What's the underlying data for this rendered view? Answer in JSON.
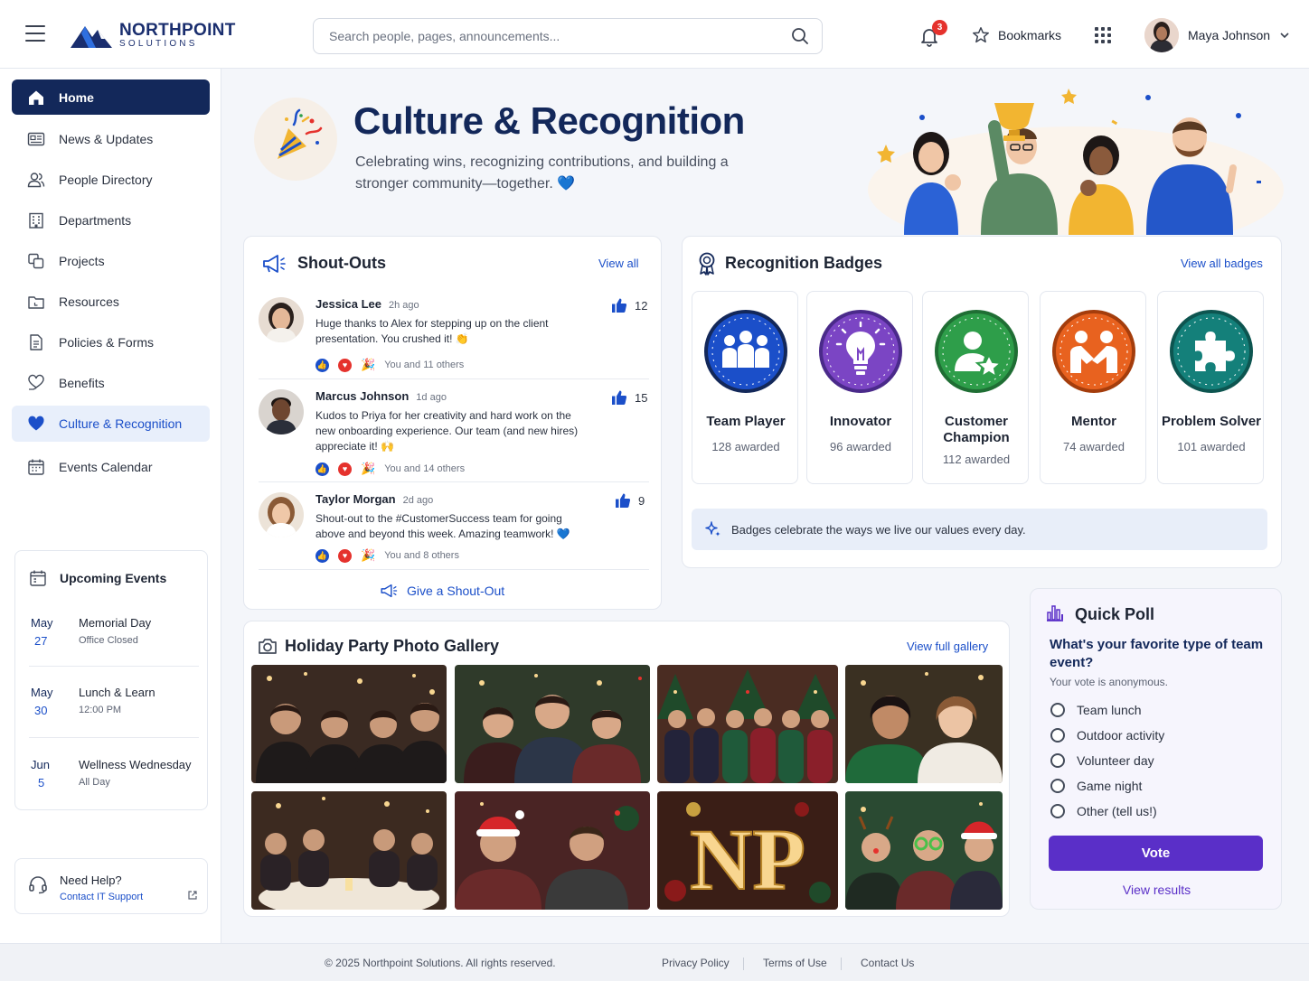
{
  "brand": {
    "name_line1": "NORTHPOINT",
    "name_line2": "SOLUTIONS",
    "color": "#13285a",
    "accent": "#1b4fc9"
  },
  "header": {
    "search_placeholder": "Search people, pages, announcements...",
    "notification_count": "3",
    "bookmarks_label": "Bookmarks",
    "user_name": "Maya Johnson"
  },
  "sidebar": {
    "items": [
      {
        "label": "Home",
        "icon": "home-icon"
      },
      {
        "label": "News & Updates",
        "icon": "newspaper-icon"
      },
      {
        "label": "People Directory",
        "icon": "people-icon"
      },
      {
        "label": "Departments",
        "icon": "building-icon"
      },
      {
        "label": "Projects",
        "icon": "projects-icon"
      },
      {
        "label": "Resources",
        "icon": "folder-icon"
      },
      {
        "label": "Policies & Forms",
        "icon": "document-icon"
      },
      {
        "label": "Benefits",
        "icon": "heart-hand-icon"
      },
      {
        "label": "Culture & Recognition",
        "icon": "heart-icon"
      },
      {
        "label": "Events Calendar",
        "icon": "calendar-icon"
      }
    ],
    "events": {
      "title": "Upcoming Events",
      "list": [
        {
          "month": "May",
          "day": "27",
          "title": "Memorial Day",
          "sub": "Office Closed"
        },
        {
          "month": "May",
          "day": "30",
          "title": "Lunch & Learn",
          "sub": "12:00 PM"
        },
        {
          "month": "Jun",
          "day": "5",
          "title": "Wellness Wednesday",
          "sub": "All Day"
        }
      ]
    },
    "help": {
      "title": "Need Help?",
      "link": "Contact IT Support"
    }
  },
  "hero": {
    "title": "Culture & Recognition",
    "subtitle": "Celebrating wins, recognizing contributions, and building a stronger community—together. 💙"
  },
  "shoutouts": {
    "title": "Shout-Outs",
    "view_all": "View all",
    "items": [
      {
        "name": "Jessica Lee",
        "time": "2h ago",
        "text": "Huge thanks to Alex for stepping up on the client presentation. You crushed it! 👏",
        "likes": "12",
        "reactions": "You and 11 others"
      },
      {
        "name": "Marcus Johnson",
        "time": "1d ago",
        "text": "Kudos to Priya for her creativity and hard work on the new onboarding experience. Our team (and new hires) appreciate it! 🙌",
        "likes": "15",
        "reactions": "You and 14 others"
      },
      {
        "name": "Taylor Morgan",
        "time": "2d ago",
        "text": "Shout-out to the #CustomerSuccess team for going above and beyond this week. Amazing teamwork! 💙",
        "likes": "9",
        "reactions": "You and 8 others"
      }
    ],
    "give_label": "Give a Shout-Out"
  },
  "badges": {
    "title": "Recognition Badges",
    "view_all": "View all badges",
    "items": [
      {
        "name": "Team Player",
        "count": "128 awarded",
        "color": "#1b4fc9",
        "icon": "team-icon"
      },
      {
        "name": "Innovator",
        "count": "96 awarded",
        "color": "#7b45c4",
        "icon": "lightbulb-icon"
      },
      {
        "name": "Customer Champion",
        "count": "112 awarded",
        "color": "#2e9e4a",
        "icon": "person-star-icon"
      },
      {
        "name": "Mentor",
        "count": "74 awarded",
        "color": "#e8621f",
        "icon": "handshake-icon"
      },
      {
        "name": "Problem Solver",
        "count": "101 awarded",
        "color": "#14807a",
        "icon": "puzzle-icon"
      }
    ],
    "values_note": "Badges celebrate the ways we live our values every day."
  },
  "gallery": {
    "title": "Holiday Party Photo Gallery",
    "view_all": "View full gallery",
    "photo_text": "NP"
  },
  "poll": {
    "title": "Quick Poll",
    "question": "What's your favorite type of team event?",
    "note": "Your vote is anonymous.",
    "options": [
      "Team lunch",
      "Outdoor activity",
      "Volunteer day",
      "Game night",
      "Other (tell us!)"
    ],
    "vote_label": "Vote",
    "results_label": "View results",
    "accent": "#5a2fc8"
  },
  "footer": {
    "copyright": "© 2025 Northpoint Solutions. All rights reserved.",
    "links": [
      "Privacy Policy",
      "Terms of Use",
      "Contact Us"
    ]
  }
}
